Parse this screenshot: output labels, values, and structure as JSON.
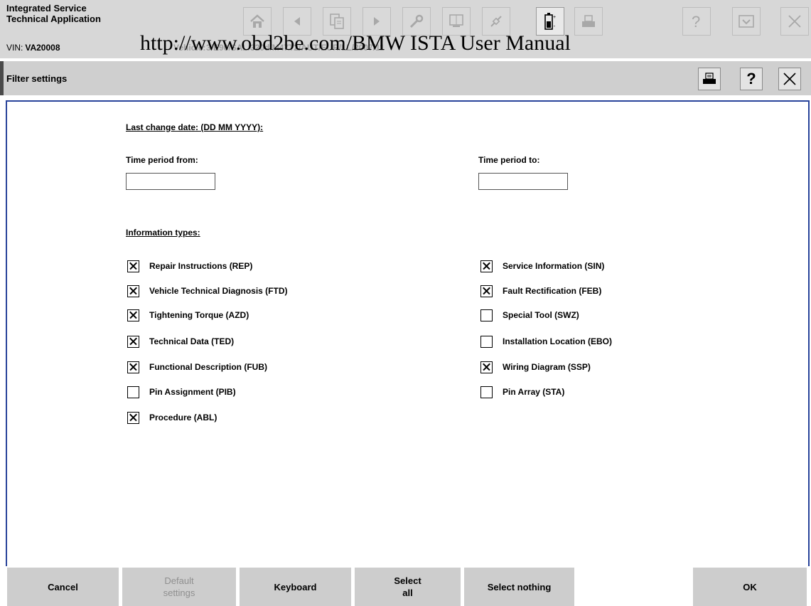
{
  "header": {
    "app_title_line1": "Integrated Service",
    "app_title_line2": "Technical Application",
    "vin_label": "VIN:",
    "vin_value": "VA20008",
    "vehicle_label": "Vehicle:",
    "vehicle_value": "3/E90/SAL/320d/M47T2/AUT/EUR/LL/2007/11",
    "watermark": "http://www.obd2be.com/BMW ISTA User Manual",
    "toolbar_icons": [
      "home-icon",
      "back-icon",
      "documents-icon",
      "forward-icon",
      "wrench-icon",
      "measurement-icon",
      "connection-icon",
      "battery-icon",
      "print-icon",
      "help-icon",
      "minimize-icon",
      "close-icon"
    ]
  },
  "titlebar": {
    "title": "Filter settings",
    "help_label": "?"
  },
  "content": {
    "date_heading": "Last change date: (DD MM YYYY):",
    "from_label": "Time period from:",
    "from_value": "",
    "to_label": "Time period to:",
    "to_value": "",
    "info_heading": "Information types:",
    "left_types": [
      {
        "label": "Repair Instructions (REP)",
        "checked": true
      },
      {
        "label": "Vehicle Technical Diagnosis (FTD)",
        "checked": true
      },
      {
        "label": "Tightening Torque (AZD)",
        "checked": true
      },
      {
        "label": "Technical Data (TED)",
        "checked": true
      },
      {
        "label": "Functional Description (FUB)",
        "checked": true
      },
      {
        "label": "Pin Assignment (PIB)",
        "checked": false
      },
      {
        "label": "Procedure (ABL)",
        "checked": true
      }
    ],
    "right_types": [
      {
        "label": "Service Information (SIN)",
        "checked": true
      },
      {
        "label": "Fault Rectification (FEB)",
        "checked": true
      },
      {
        "label": "Special Tool (SWZ)",
        "checked": false
      },
      {
        "label": "Installation Location (EBO)",
        "checked": false
      },
      {
        "label": "Wiring Diagram (SSP)",
        "checked": true
      },
      {
        "label": "Pin Array (STA)",
        "checked": false
      }
    ]
  },
  "footer": {
    "cancel": "Cancel",
    "default_line1": "Default",
    "default_line2": "settings",
    "keyboard": "Keyboard",
    "select_all_line1": "Select",
    "select_all_line2": "all",
    "select_nothing": "Select nothing",
    "ok": "OK"
  },
  "colors": {
    "header_bg": "#d7d7d7",
    "content_border": "#28439a",
    "button_bg": "#cdcdcd"
  }
}
